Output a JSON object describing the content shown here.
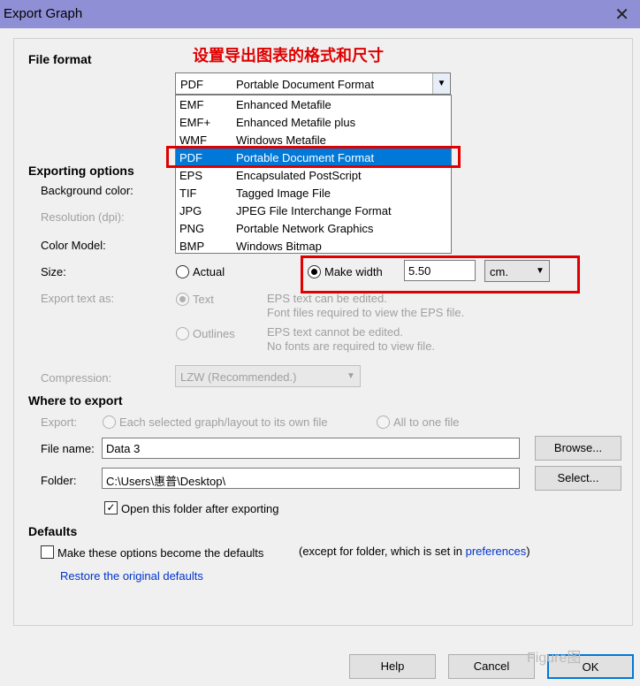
{
  "window": {
    "title": "Export Graph",
    "close_glyph": "✕"
  },
  "annotation": {
    "title": "设置导出图表的格式和尺寸"
  },
  "file_format": {
    "label": "File format",
    "selected_code": "PDF",
    "selected_name": "Portable Document Format",
    "options": [
      {
        "code": "EMF",
        "name": "Enhanced Metafile"
      },
      {
        "code": "EMF+",
        "name": "Enhanced Metafile plus"
      },
      {
        "code": "WMF",
        "name": "Windows Metafile"
      },
      {
        "code": "PDF",
        "name": "Portable Document Format"
      },
      {
        "code": "EPS",
        "name": "Encapsulated PostScript"
      },
      {
        "code": "TIF",
        "name": "Tagged Image File"
      },
      {
        "code": "JPG",
        "name": "JPEG File Interchange Format"
      },
      {
        "code": "PNG",
        "name": "Portable Network Graphics"
      },
      {
        "code": "BMP",
        "name": "Windows Bitmap"
      }
    ]
  },
  "exporting_options": {
    "label": "Exporting options",
    "background_color_label": "Background color:",
    "resolution_label": "Resolution (dpi):",
    "color_model_label": "Color Model:",
    "size_label": "Size:",
    "size_actual": "Actual",
    "size_make_width": "Make width",
    "width_value": "5.50",
    "width_unit": "cm.",
    "export_text_label": "Export text as:",
    "text_option": "Text",
    "text_desc_1": "EPS text can be edited.",
    "text_desc_2": "Font files required to view the EPS file.",
    "outlines_option": "Outlines",
    "outlines_desc_1": "EPS text cannot be edited.",
    "outlines_desc_2": "No fonts are required to view file.",
    "compression_label": "Compression:",
    "compression_value": "LZW (Recommended.)"
  },
  "where_to_export": {
    "label": "Where to export",
    "export_label": "Export:",
    "option_each": "Each selected graph/layout to its own file",
    "option_all": "All to one file",
    "file_name_label": "File name:",
    "file_name_value": "Data 3",
    "browse_button": "Browse...",
    "folder_label": "Folder:",
    "folder_value": "C:\\Users\\惠普\\Desktop\\",
    "select_button": "Select...",
    "open_folder_label": "Open this folder after exporting"
  },
  "defaults": {
    "label": "Defaults",
    "make_defaults_label": "Make these options become the defaults",
    "note_prefix": "(except for folder, which is set in ",
    "note_link": "preferences",
    "note_suffix": ")",
    "restore_link": "Restore the original defaults"
  },
  "buttons": {
    "help": "Help",
    "cancel": "Cancel",
    "ok": "OK"
  },
  "watermark": {
    "text": "Figure图"
  },
  "colors": {
    "titlebar": "#8f8fd6",
    "selection": "#0078d7",
    "highlight_box": "#e00000",
    "link": "#0033cc"
  },
  "icons": {
    "dropdown": "chevron-down-icon",
    "close": "close-icon",
    "check": "check-icon"
  }
}
